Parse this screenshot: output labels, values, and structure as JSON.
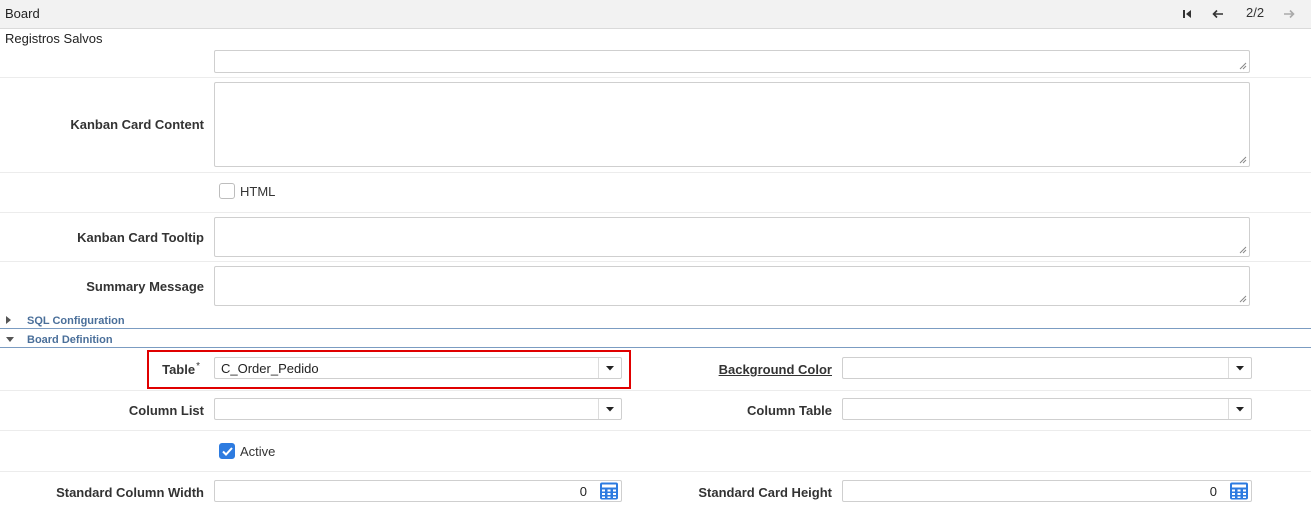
{
  "window": {
    "title": "Board",
    "pager": "2/2"
  },
  "subtitle": "Registros Salvos",
  "fields": {
    "kanban_card_content": {
      "label": "Kanban Card Content",
      "value": ""
    },
    "html_checkbox": {
      "label": "HTML",
      "checked": false
    },
    "kanban_card_tooltip": {
      "label": "Kanban Card Tooltip",
      "value": ""
    },
    "summary_message": {
      "label": "Summary Message",
      "value": ""
    }
  },
  "sections": {
    "sql": {
      "title": "SQL Configuration",
      "expanded": false
    },
    "board": {
      "title": "Board Definition",
      "expanded": true
    }
  },
  "board": {
    "table": {
      "label": "Table",
      "required_mark": "*",
      "value": "C_Order_Pedido"
    },
    "background_color": {
      "label": "Background Color",
      "value": ""
    },
    "column_list": {
      "label": "Column List",
      "value": ""
    },
    "column_table": {
      "label": "Column Table",
      "value": ""
    },
    "active": {
      "label": "Active",
      "checked": true
    },
    "standard_column_width": {
      "label": "Standard Column Width",
      "value": "0"
    },
    "standard_card_height": {
      "label": "Standard Card Height",
      "value": "0"
    }
  },
  "icons": [
    "first-record-icon",
    "previous-record-icon",
    "next-record-icon",
    "dropdown-arrow-icon",
    "calculator-icon",
    "resize-grip-icon",
    "checkmark-icon",
    "collapsed-arrow-icon",
    "expanded-arrow-icon"
  ],
  "colors": {
    "section_title": "#4a6f9a",
    "highlight": "#e00000",
    "checkbox_on": "#2d7be0"
  }
}
